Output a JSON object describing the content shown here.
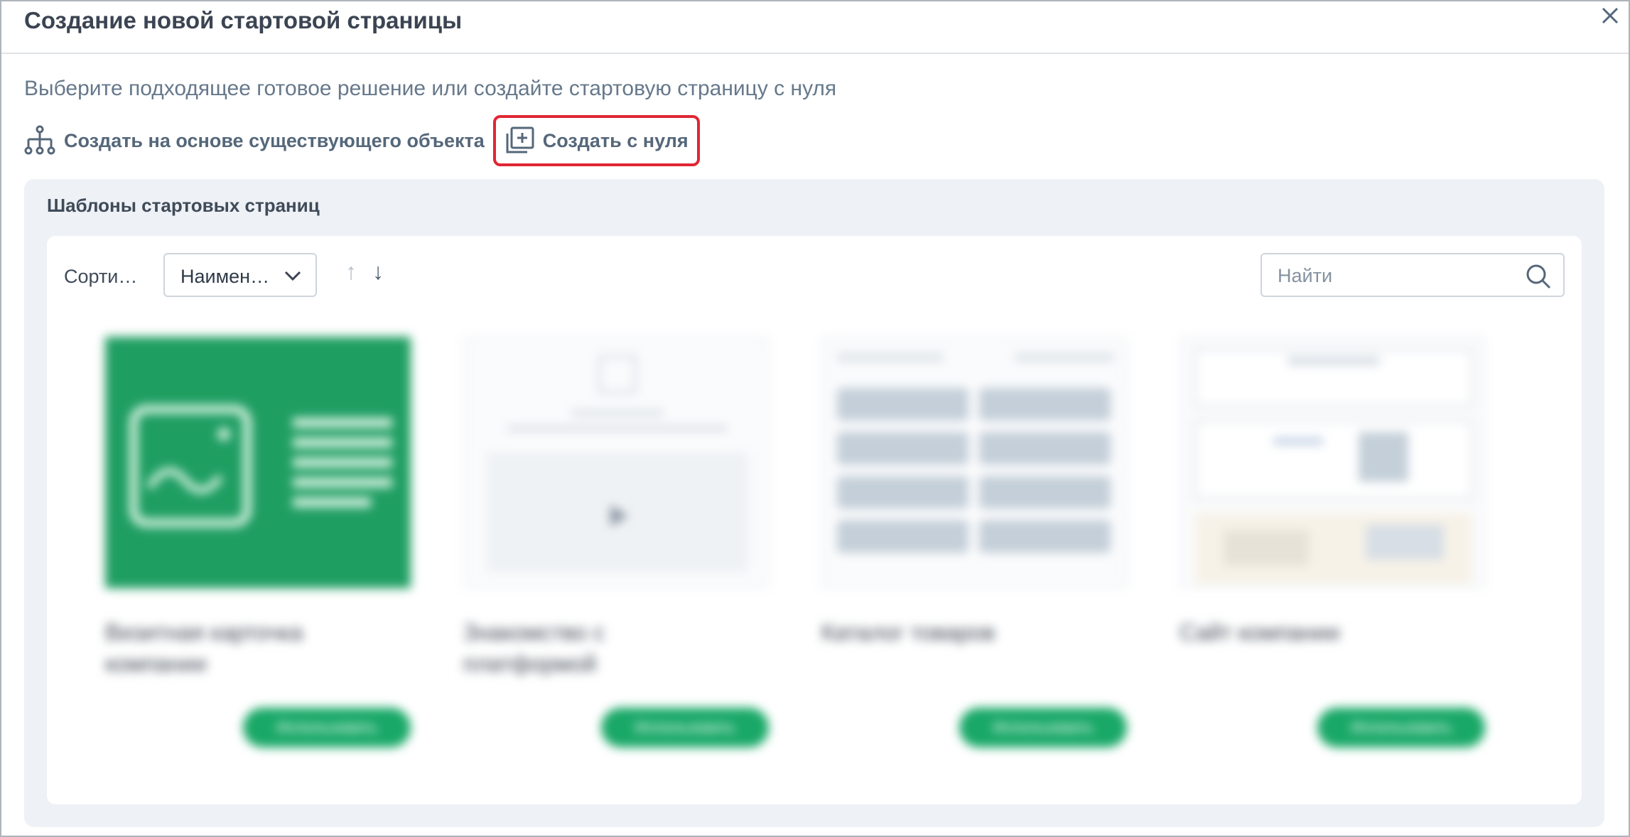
{
  "dialog": {
    "title": "Создание новой стартовой страницы",
    "subtitle": "Выберите подходящее готовое решение или создайте стартовую страницу с нуля"
  },
  "actions": {
    "from_existing": "Создать на основе существующего объекта",
    "from_scratch": "Создать с нуля"
  },
  "templates": {
    "section_title": "Шаблоны стартовых страниц",
    "sort_label": "Сорти…",
    "sort_value": "Наимен…",
    "search_placeholder": "Найти",
    "cards": [
      {
        "title": "Визитная карточка компании",
        "button": "Использовать"
      },
      {
        "title": "Знакомство с платформой",
        "button": "Использовать"
      },
      {
        "title": "Каталог товаров",
        "button": "Использовать"
      },
      {
        "title": "Сайт компании",
        "button": "Использовать"
      }
    ]
  },
  "colors": {
    "accent_green": "#19a867",
    "highlight_red": "#e02634"
  },
  "icons": {
    "close": "close-icon",
    "hierarchy": "hierarchy-icon",
    "add_page": "add-page-icon",
    "dropdown": "chevron-down-icon",
    "search": "search-icon"
  }
}
